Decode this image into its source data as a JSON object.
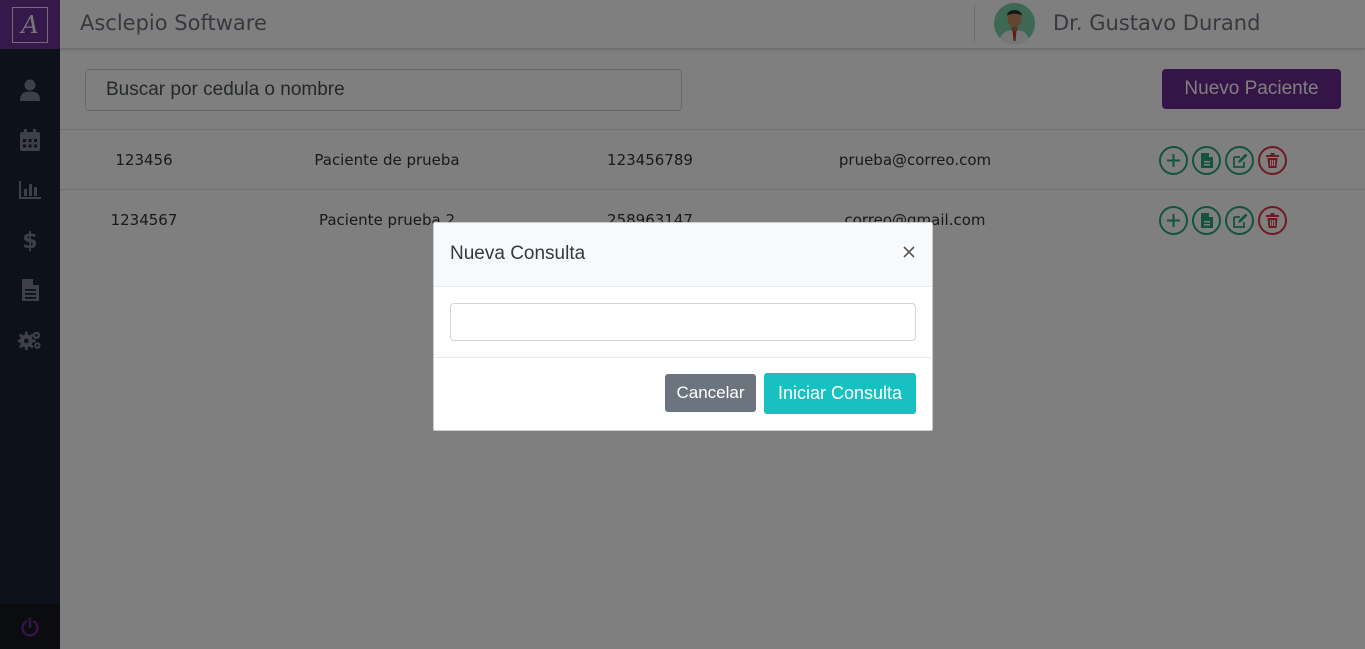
{
  "sidebar": {
    "logo_letter": "A",
    "items": [
      {
        "icon": "user-icon"
      },
      {
        "icon": "calendar-icon"
      },
      {
        "icon": "bar-chart-icon"
      },
      {
        "icon": "dollar-icon"
      },
      {
        "icon": "document-icon"
      },
      {
        "icon": "gears-icon"
      }
    ],
    "power_icon": "power-icon"
  },
  "header": {
    "app_title": "Asclepio Software",
    "user_name": "Dr. Gustavo Durand"
  },
  "toolbar": {
    "search_placeholder": "Buscar por cedula o nombre",
    "new_patient_label": "Nuevo Paciente"
  },
  "patients": [
    {
      "cedula": "123456",
      "nombre": "Paciente de prueba",
      "telefono": "123456789",
      "correo": "prueba@correo.com"
    },
    {
      "cedula": "1234567",
      "nombre": "Paciente prueba 2",
      "telefono": "258963147",
      "correo": "correo@gmail.com"
    }
  ],
  "modal": {
    "title": "Nueva Consulta",
    "input_value": "",
    "cancel_label": "Cancelar",
    "start_label": "Iniciar Consulta"
  },
  "colors": {
    "brand": "#6b2a8e",
    "sidebar": "#1b2333",
    "action_green": "#28a77a",
    "action_red": "#dc3545",
    "primary_teal": "#17c1c1"
  }
}
